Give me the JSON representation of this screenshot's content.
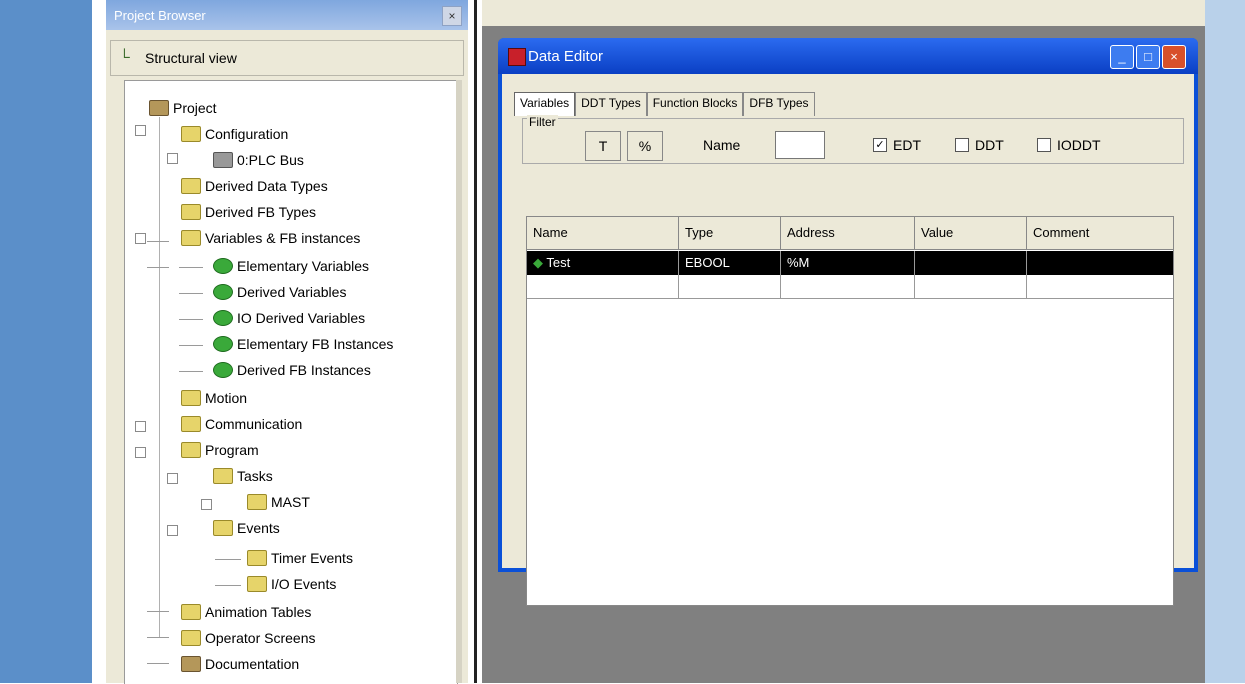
{
  "project_browser": {
    "title": "Project Browser",
    "close_label": "×",
    "view_label": "Structural view",
    "tree": [
      {
        "label": "Project",
        "icon": "doc"
      },
      {
        "label": "Configuration",
        "icon": "folder"
      },
      {
        "label": "0:PLC Bus",
        "icon": "chip"
      },
      {
        "label": "Derived Data Types",
        "icon": "folder"
      },
      {
        "label": "Derived FB Types",
        "icon": "folder"
      },
      {
        "label": "Variables & FB instances",
        "icon": "folder"
      },
      {
        "label": "Elementary Variables",
        "icon": "gear"
      },
      {
        "label": "Derived Variables",
        "icon": "gear"
      },
      {
        "label": "IO Derived Variables",
        "icon": "gear"
      },
      {
        "label": "Elementary FB Instances",
        "icon": "gear"
      },
      {
        "label": "Derived FB Instances",
        "icon": "gear"
      },
      {
        "label": "Motion",
        "icon": "folder"
      },
      {
        "label": "Communication",
        "icon": "folder"
      },
      {
        "label": "Program",
        "icon": "folder"
      },
      {
        "label": "Tasks",
        "icon": "folder"
      },
      {
        "label": "MAST",
        "icon": "folder"
      },
      {
        "label": "Events",
        "icon": "folder"
      },
      {
        "label": "Timer Events",
        "icon": "folder"
      },
      {
        "label": "I/O Events",
        "icon": "folder"
      },
      {
        "label": "Animation Tables",
        "icon": "folder"
      },
      {
        "label": "Operator Screens",
        "icon": "folder"
      },
      {
        "label": "Documentation",
        "icon": "doc"
      }
    ]
  },
  "data_editor": {
    "title": "Data Editor",
    "window_buttons": {
      "minimize": "_",
      "maximize": "□",
      "close": "×"
    },
    "tabs": [
      "Variables",
      "DDT Types",
      "Function Blocks",
      "DFB Types"
    ],
    "filter": {
      "group_label": "Filter",
      "filter_btn": "T",
      "refresh_btn": "%",
      "name_label": "Name",
      "name_value": "",
      "check_edt": {
        "label": "EDT",
        "checked": true
      },
      "check_ddt": {
        "label": "DDT",
        "checked": false
      },
      "check_iodt": {
        "label": "IODDT",
        "checked": false
      }
    },
    "grid": {
      "columns": [
        "Name",
        "Type",
        "Address",
        "Value",
        "Comment"
      ],
      "rows": [
        {
          "name": "Test",
          "type": "EBOOL",
          "address": "%M",
          "value": "",
          "comment": ""
        },
        {
          "name": "",
          "type": "",
          "address": "",
          "value": "",
          "comment": ""
        }
      ]
    }
  }
}
